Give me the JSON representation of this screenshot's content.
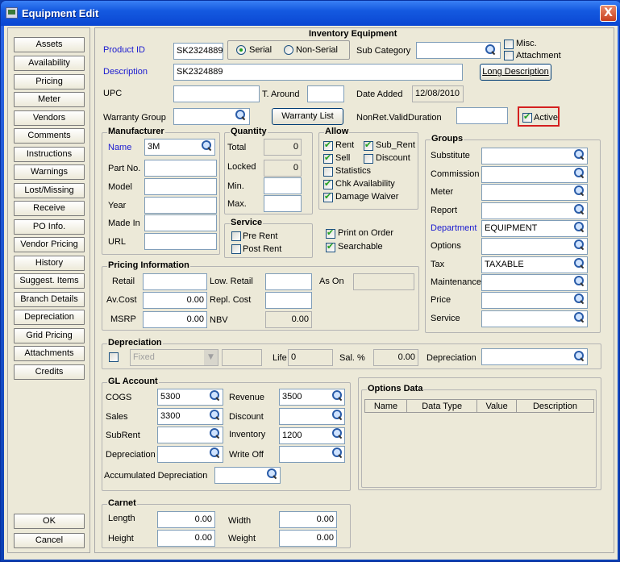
{
  "window": {
    "title": "Equipment Edit",
    "close_label": "X"
  },
  "nav": {
    "items": [
      "Assets",
      "Availability",
      "Pricing",
      "Meter",
      "Vendors",
      "Comments",
      "Instructions",
      "Warnings",
      "Lost/Missing",
      "Receive",
      "PO Info.",
      "Vendor Pricing",
      "History",
      "Suggest. Items",
      "Branch Details",
      "Depreciation",
      "Grid Pricing",
      "Attachments",
      "Credits"
    ],
    "ok_label": "OK",
    "cancel_label": "Cancel"
  },
  "inventory": {
    "section_title": "Inventory Equipment",
    "product_id_label": "Product ID",
    "product_id_value": "SK2324889",
    "serial_label": "Serial",
    "nonserial_label": "Non-Serial",
    "serial_selected": true,
    "sub_category_label": "Sub Category",
    "sub_category_value": "",
    "misc_label": "Misc.",
    "attachment_label": "Attachment",
    "description_label": "Description",
    "description_value": "SK2324889",
    "long_description_label": "Long Description",
    "upc_label": "UPC",
    "upc_value": "",
    "taround_label": "T. Around",
    "taround_value": "",
    "date_added_label": "Date Added",
    "date_added_value": "12/08/2010",
    "warranty_group_label": "Warranty Group",
    "warranty_group_value": "",
    "warranty_list_label": "Warranty List",
    "nonret_label": "NonRet.ValidDuration",
    "nonret_value": "",
    "active_label": "Active",
    "active_checked": true
  },
  "manufacturer": {
    "title": "Manufacturer",
    "name_label": "Name",
    "name_value": "3M",
    "partno_label": "Part No.",
    "partno_value": "",
    "model_label": "Model",
    "model_value": "",
    "year_label": "Year",
    "year_value": "",
    "madein_label": "Made In",
    "madein_value": "",
    "url_label": "URL",
    "url_value": ""
  },
  "quantity": {
    "title": "Quantity",
    "total_label": "Total",
    "total_value": "0",
    "locked_label": "Locked",
    "locked_value": "0",
    "min_label": "Min.",
    "min_value": "",
    "max_label": "Max.",
    "max_value": ""
  },
  "service": {
    "title": "Service",
    "pre_rent_label": "Pre Rent",
    "post_rent_label": "Post Rent"
  },
  "allow": {
    "title": "Allow",
    "rent_label": "Rent",
    "sub_rent_label": "Sub_Rent",
    "sell_label": "Sell",
    "discount_label": "Discount",
    "statistics_label": "Statistics",
    "chk_availability_label": "Chk Availability",
    "damage_waiver_label": "Damage Waiver",
    "print_on_order_label": "Print on Order",
    "searchable_label": "Searchable"
  },
  "groups": {
    "title": "Groups",
    "substitute_label": "Substitute",
    "substitute_value": "",
    "commission_label": "Commission",
    "commission_value": "",
    "meter_label": "Meter",
    "meter_value": "",
    "report_label": "Report",
    "report_value": "",
    "department_label": "Department",
    "department_value": "EQUIPMENT",
    "options_label": "Options",
    "options_value": "",
    "tax_label": "Tax",
    "tax_value": "TAXABLE",
    "maintenance_label": "Maintenance",
    "maintenance_value": "",
    "price_label": "Price",
    "price_value": "",
    "service_label": "Service",
    "service_value": ""
  },
  "pricing": {
    "title": "Pricing Information",
    "retail_label": "Retail",
    "retail_value": "",
    "low_retail_label": "Low. Retail",
    "low_retail_value": "",
    "as_on_label": "As On",
    "as_on_value": "",
    "avcost_label": "Av.Cost",
    "avcost_value": "0.00",
    "repl_cost_label": "Repl. Cost",
    "repl_cost_value": "",
    "msrp_label": "MSRP",
    "msrp_value": "0.00",
    "nbv_label": "NBV",
    "nbv_value": "0.00"
  },
  "depreciation": {
    "title": "Depreciation",
    "method_value": "Fixed",
    "life_label": "Life",
    "life_value": "0",
    "sal_label": "Sal. %",
    "sal_value": "0.00",
    "depreciation_label": "Depreciation",
    "depreciation_value": ""
  },
  "gl": {
    "title": "GL Account",
    "cogs_label": "COGS",
    "cogs_value": "5300",
    "revenue_label": "Revenue",
    "revenue_value": "3500",
    "sales_label": "Sales",
    "sales_value": "3300",
    "discount_label": "Discount",
    "discount_value": "",
    "subrent_label": "SubRent",
    "subrent_value": "",
    "inventory_label": "Inventory",
    "inventory_value": "1200",
    "depreciation_label": "Depreciation",
    "depreciation_value": "",
    "writeoff_label": "Write Off",
    "writeoff_value": "",
    "accum_label": "Accumulated Depreciation",
    "accum_value": ""
  },
  "options_data": {
    "title": "Options Data",
    "columns": [
      "Name",
      "Data Type",
      "Value",
      "Description"
    ]
  },
  "carnet": {
    "title": "Carnet",
    "length_label": "Length",
    "length_value": "0.00",
    "width_label": "Width",
    "width_value": "0.00",
    "height_label": "Height",
    "height_value": "0.00",
    "weight_label": "Weight",
    "weight_value": "0.00"
  }
}
